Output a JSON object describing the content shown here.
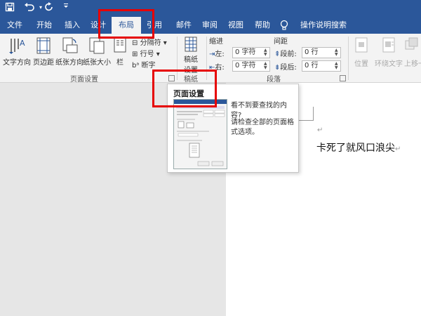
{
  "quick_access": {
    "save_icon": "save-icon",
    "undo_icon": "undo-icon",
    "redo_icon": "redo-icon",
    "customize_icon": "customize-icon"
  },
  "tabs": [
    {
      "label": "文件"
    },
    {
      "label": "开始"
    },
    {
      "label": "插入"
    },
    {
      "label": "设计"
    },
    {
      "label": "布局"
    },
    {
      "label": "引用"
    },
    {
      "label": "邮件"
    },
    {
      "label": "审阅"
    },
    {
      "label": "视图"
    },
    {
      "label": "帮助"
    },
    {
      "label": "操作说明搜索"
    }
  ],
  "active_tab": "布局",
  "ribbon": {
    "page_setup": {
      "text_direction": "文字方向",
      "margins": "页边距",
      "orientation": "纸张方向",
      "size": "纸张大小",
      "columns": "栏",
      "breaks": "分隔符",
      "line_numbers": "行号",
      "hyphenation": "断字",
      "group_label": "页面设置"
    },
    "manuscript": {
      "button_line1": "稿纸",
      "button_line2": "设置",
      "group_label": "稿纸"
    },
    "paragraph": {
      "indent_label": "缩进",
      "spacing_label": "间距",
      "left_label": "左:",
      "right_label": "右:",
      "left_value": "0 字符",
      "right_value": "0 字符",
      "before_label": "段前:",
      "after_label": "段后:",
      "before_value": "0 行",
      "after_value": "0 行",
      "group_label": "段落"
    },
    "arrange": {
      "position": "位置",
      "wrap_text": "环绕文字",
      "bring_forward": "上移一"
    }
  },
  "tooltip": {
    "title": "页面设置",
    "line1": "看不到要查找的内容?",
    "line2": "请检查全部的页面格式选项。"
  },
  "document": {
    "body_text": "卡死了就风口浪尖",
    "para_mark": "↵"
  },
  "colors": {
    "title_bar": "#2b579a",
    "highlight": "#e60000"
  }
}
